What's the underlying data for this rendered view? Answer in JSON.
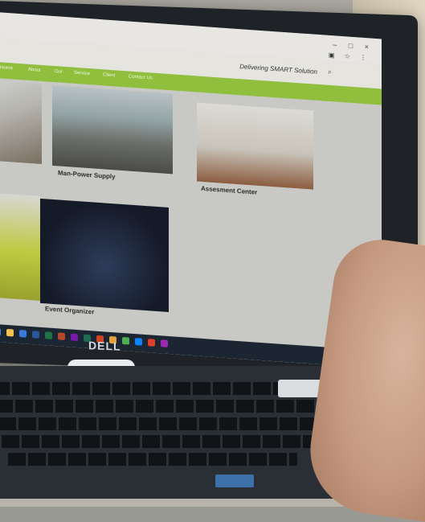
{
  "browser": {
    "window_controls": "– □ ×"
  },
  "site": {
    "tagline": "Delivering SMART Solution",
    "nav": [
      "Home",
      "About",
      "Our",
      "Service",
      "Client",
      "Contact Us"
    ]
  },
  "cards": [
    {
      "caption": ""
    },
    {
      "caption": "Man-Power Supply"
    },
    {
      "caption": "Assesment Center"
    },
    {
      "caption": ""
    },
    {
      "caption": "Event Organizer"
    }
  ],
  "laptop": {
    "brand": "DELL"
  },
  "colors": {
    "nav_green": "#8fbf3c",
    "fab_green": "#6aa84f",
    "taskbar": "#1c2633"
  }
}
